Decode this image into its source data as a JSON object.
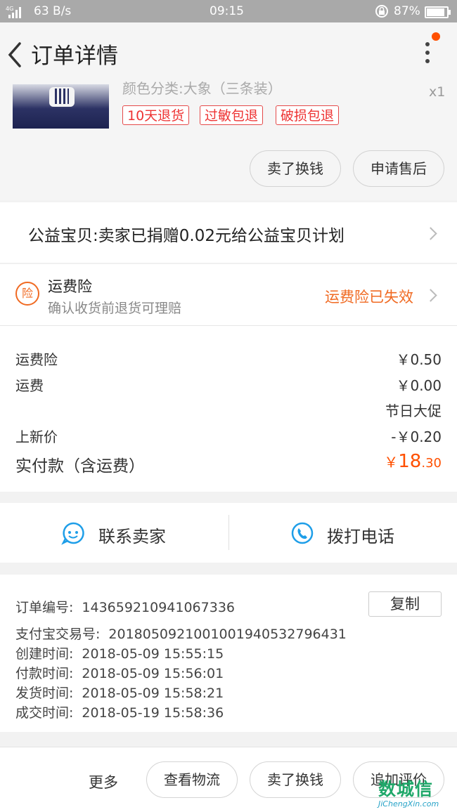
{
  "status_bar": {
    "network_type": "4G",
    "speed": "63 B/s",
    "time": "09:15",
    "battery": "87%"
  },
  "nav": {
    "title": "订单详情"
  },
  "product": {
    "sku": "颜色分类:大象（三条装）",
    "quantity": "x1",
    "tags": [
      "10天退货",
      "过敏包退",
      "破损包退"
    ],
    "actions": {
      "sell": "卖了换钱",
      "after_sale": "申请售后"
    }
  },
  "charity": {
    "text": "公益宝贝:卖家已捐赠0.02元给公益宝贝计划"
  },
  "insurance": {
    "badge": "险",
    "name": "运费险",
    "desc": "确认收货前退货可理赔",
    "status": "运费险已失效"
  },
  "price": {
    "insurance_label": "运费险",
    "insurance_value": "￥0.50",
    "shipping_label": "运费",
    "shipping_value": "￥0.00",
    "promo_label": "节日大促",
    "new_price_label": "上新价",
    "new_price_value": "-￥0.20",
    "total_label": "实付款（含运费）",
    "total_currency": "￥",
    "total_int": "18",
    "total_dec": ".30"
  },
  "contact": {
    "seller": "联系卖家",
    "phone": "拨打电话"
  },
  "order_meta": {
    "order_no_label": "订单编号:",
    "order_no": "143659210941067336",
    "copy_label": "复制",
    "alipay_label": "支付宝交易号:",
    "alipay_no": "2018050921001001940532796431",
    "created_label": "创建时间:",
    "created": "2018-05-09 15:55:15",
    "paid_label": "付款时间:",
    "paid": "2018-05-09 15:56:01",
    "shipped_label": "发货时间:",
    "shipped": "2018-05-09 15:58:21",
    "done_label": "成交时间:",
    "done": "2018-05-19 15:58:36"
  },
  "bottom_bar": {
    "more": "更多",
    "logistics": "查看物流",
    "sell": "卖了换钱",
    "review": "追加评价"
  },
  "watermark": {
    "main": "数城信",
    "sub": "JiChengXin.com"
  },
  "colors": {
    "accent": "#ff5000",
    "insurance_orange": "#f06a22",
    "tag_red": "#e33",
    "contact_blue": "#1e9ee8"
  }
}
